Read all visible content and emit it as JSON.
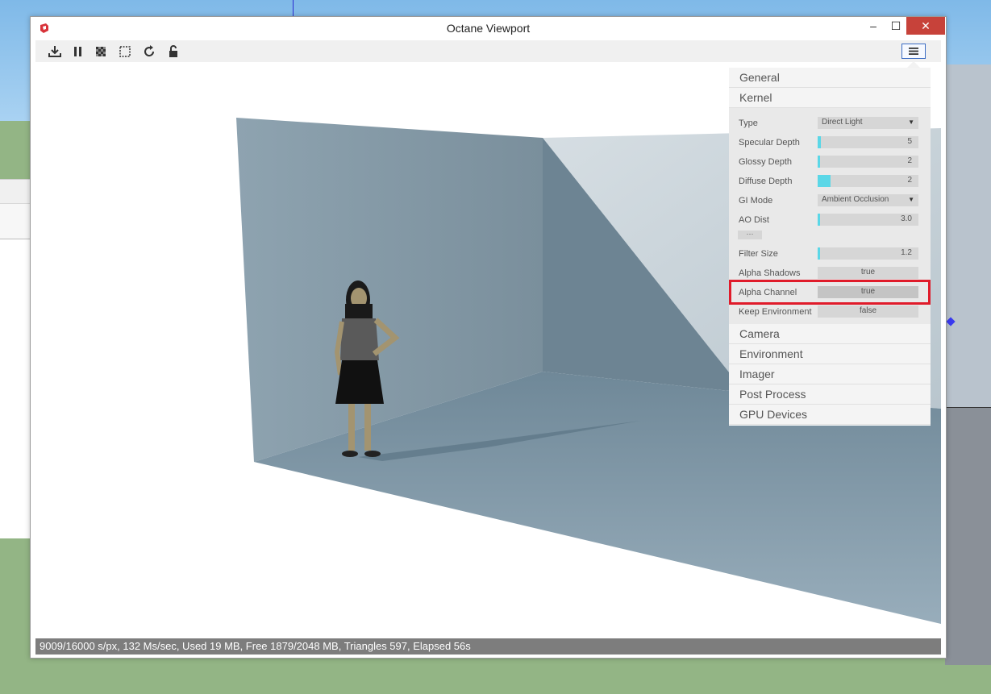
{
  "window": {
    "title": "Octane Viewport",
    "minimize_glyph": "–",
    "maximize_glyph": "☐",
    "close_glyph": "✕"
  },
  "toolbar": {
    "icons": [
      "download-icon",
      "pause-icon",
      "checkerboard-icon",
      "region-select-icon",
      "refresh-icon",
      "lock-icon",
      "hamburger-menu-icon"
    ]
  },
  "status": {
    "text": "9009/16000 s/px, 132 Ms/sec, Used 19 MB, Free 1879/2048 MB, Triangles 597, Elapsed 56s"
  },
  "settings": {
    "sections_top": [
      "General",
      "Kernel"
    ],
    "kernel": {
      "type": {
        "label": "Type",
        "value": "Direct Light"
      },
      "specular_depth": {
        "label": "Specular Depth",
        "value": "5",
        "fill": 0.03
      },
      "glossy_depth": {
        "label": "Glossy Depth",
        "value": "2",
        "fill": 0.01
      },
      "diffuse_depth": {
        "label": "Diffuse Depth",
        "value": "2",
        "fill": 0.13
      },
      "gi_mode": {
        "label": "GI Mode",
        "value": "Ambient Occlusion"
      },
      "ao_dist": {
        "label": "AO Dist",
        "value": "3.0",
        "fill": 0.01
      },
      "more": "···",
      "filter_size": {
        "label": "Filter Size",
        "value": "1.2",
        "fill": 0.01
      },
      "alpha_shadows": {
        "label": "Alpha Shadows",
        "value": "true"
      },
      "alpha_channel": {
        "label": "Alpha Channel",
        "value": "true"
      },
      "keep_environment": {
        "label": "Keep Environment",
        "value": "false"
      }
    },
    "sections_bottom": [
      "Camera",
      "Environment",
      "Imager",
      "Post Process",
      "GPU Devices"
    ]
  },
  "colors": {
    "accent_fill": "#5bd7e7",
    "highlight": "#e01b2a",
    "close_button": "#c7423a"
  }
}
